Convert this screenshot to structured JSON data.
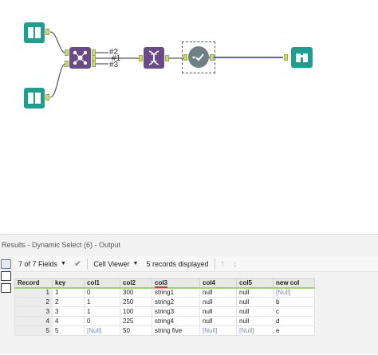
{
  "workflow": {
    "output_labels": [
      "#2",
      "#1",
      "#3"
    ]
  },
  "results": {
    "title": "Results - Dynamic Select (6) - Output",
    "fields_label": "7 of 7 Fields",
    "viewer_label": "Cell Viewer",
    "records_label": "5 records displayed",
    "columns": [
      "Record",
      "key",
      "col1",
      "col2",
      "col3",
      "col4",
      "col5",
      "new col"
    ],
    "rows": [
      [
        "1",
        "1",
        "0",
        "300",
        "string1",
        "null",
        "null",
        "[Null]"
      ],
      [
        "2",
        "2",
        "1",
        "250",
        "string2",
        "null",
        "null",
        "b"
      ],
      [
        "3",
        "3",
        "1",
        "100",
        "string3",
        "null",
        "null",
        "c"
      ],
      [
        "4",
        "4",
        "0",
        "225",
        "string4",
        "null",
        "null",
        "d"
      ],
      [
        "5",
        "5",
        "[Null]",
        "50",
        "string five",
        "[Null]",
        "[Null]",
        "e"
      ]
    ]
  },
  "icons": {
    "input": "book-icon",
    "union": "union-icon",
    "dynamic_select": "dna-icon",
    "select": "check-icon",
    "browse": "binoculars-icon"
  },
  "colors": {
    "teal": "#1e9e8d",
    "purple": "#6b4a8a",
    "connector": "#2c2cb0",
    "anchor": "#c9d96a",
    "header_underline": "#9fd36d"
  }
}
